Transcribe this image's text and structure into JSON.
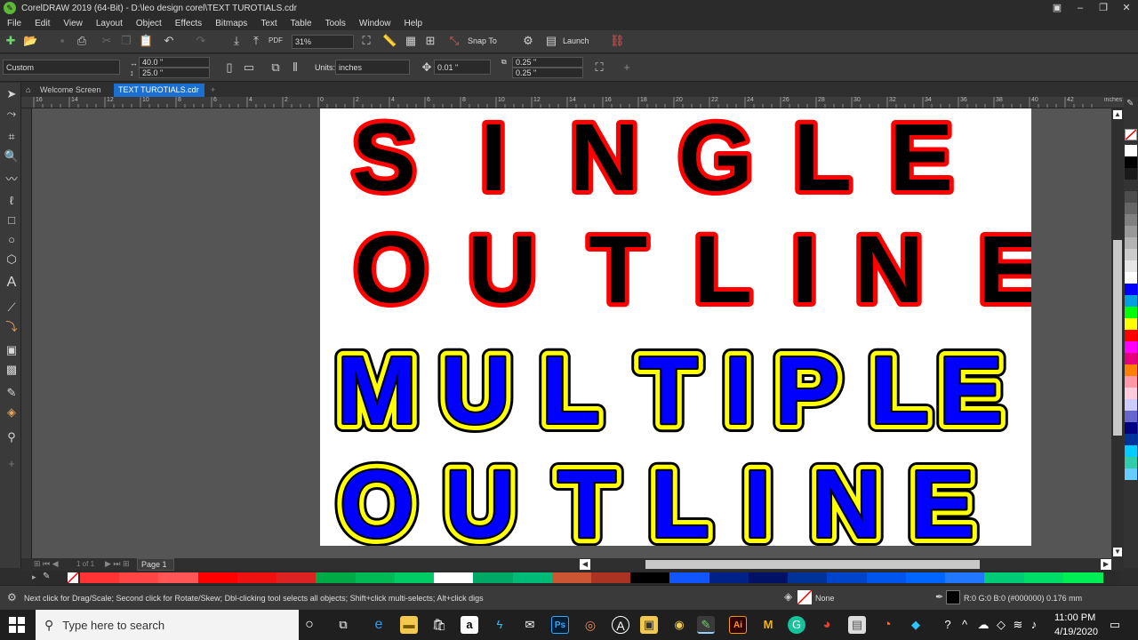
{
  "window": {
    "title": "CorelDRAW 2019 (64-Bit) - D:\\leo design corel\\TEXT TUROTIALS.cdr"
  },
  "menu": [
    "File",
    "Edit",
    "View",
    "Layout",
    "Object",
    "Effects",
    "Bitmaps",
    "Text",
    "Table",
    "Tools",
    "Window",
    "Help"
  ],
  "toolbar": {
    "zoom": "31%",
    "snap_to": "Snap To",
    "launch": "Launch"
  },
  "propbar": {
    "page_size": "Custom",
    "width": "40.0 \"",
    "height": "25.0 \"",
    "units_label": "Units:",
    "units_value": "inches",
    "nudge": "0.01 \"",
    "dup_x": "0.25 \"",
    "dup_y": "0.25 \""
  },
  "tabs": {
    "welcome": "Welcome Screen",
    "document": "TEXT TUROTIALS.cdr"
  },
  "ruler_h": [
    "16",
    "14",
    "12",
    "10",
    "8",
    "6",
    "4",
    "2",
    "0",
    "2",
    "4",
    "6",
    "8",
    "10",
    "12",
    "14",
    "16",
    "18",
    "20",
    "22",
    "24",
    "26",
    "28",
    "30",
    "32",
    "34",
    "36",
    "38",
    "40",
    "42"
  ],
  "ruler_unit": "inches",
  "artwork": {
    "line1": "SINGLE",
    "line2": "OUTLINE",
    "line3": "MULTIPLE",
    "line4": "OUTLINE",
    "colors": {
      "single_fill": "#000000",
      "single_outline": "#ff0000",
      "multi_fill": "#0000ff",
      "multi_outline_inner": "#ffff00",
      "multi_outline_outer": "#000000"
    }
  },
  "page_nav": {
    "page_count": "1 of 1",
    "page_tab": "Page 1"
  },
  "status": {
    "hint": "Next click for Drag/Scale; Second click for Rotate/Skew; Dbl-clicking tool selects all objects; Shift+click multi-selects; Alt+click digs",
    "fill": "None",
    "outline": "R:0 G:0 B:0 (#000000)  0.176 mm"
  },
  "taskbar": {
    "search_placeholder": "Type here to search",
    "time": "11:00 PM",
    "date": "4/19/2020"
  },
  "palette_right": [
    "#ffffff",
    "#000000",
    "#1a1a1a",
    "#333333",
    "#4d4d4d",
    "#666666",
    "#808080",
    "#999999",
    "#b3b3b3",
    "#cccccc",
    "#e6e6e6",
    "#ffffff",
    "#0000ff",
    "#00a0e0",
    "#00ff00",
    "#ffff00",
    "#ff0000",
    "#ff00ff",
    "#e6007e",
    "#ff8000",
    "#ff99aa",
    "#ffccdd",
    "#ccccff",
    "#6666cc",
    "#000080",
    "#003399",
    "#00ccff",
    "#33ccaa",
    "#66ccff"
  ],
  "palette_bottom": [
    "#ff3333",
    "#ff4444",
    "#ff5555",
    "#ff0000",
    "#ee1111",
    "#dd2222",
    "#00aa44",
    "#00bb55",
    "#00cc66",
    "#ffffff",
    "#00aa66",
    "#00bb77",
    "#cc5533",
    "#aa3322",
    "#000000",
    "#1155ff",
    "#002288",
    "#001166",
    "#003399",
    "#0044cc",
    "#0055ee",
    "#0066ff",
    "#2277ff",
    "#00cc77",
    "#00dd66",
    "#00ee55"
  ]
}
